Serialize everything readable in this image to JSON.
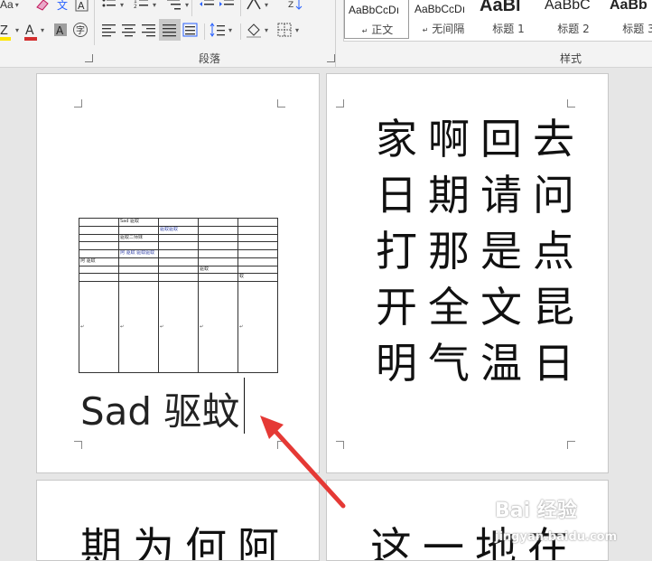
{
  "ribbon": {
    "paragraph_group_label": "段落",
    "styles_group_label": "样式",
    "font_cutoff_text": "Aa",
    "font_color": "#d32f2f",
    "highlight_color": "#ffe600",
    "styles": [
      {
        "sample": "AaBbCcDı",
        "name": "正文",
        "selected": true
      },
      {
        "sample": "AaBbCcDı",
        "name": "无间隔",
        "selected": false
      },
      {
        "sample": "AaBl",
        "name": "标题 1",
        "selected": false
      },
      {
        "sample": "AaBbC",
        "name": "标题 2",
        "selected": false
      },
      {
        "sample": "AaBb",
        "name": "标题 3",
        "selected": false
      }
    ]
  },
  "pages": {
    "page1": {
      "body_text": "Sad 驱蚊",
      "table": {
        "cells": [
          [
            "",
            "Sad 驱蚊",
            "",
            "",
            ""
          ],
          [
            "",
            "",
            "驱蚊驱蚊",
            "",
            ""
          ],
          [
            "",
            "驱蚊二师妹",
            "",
            "",
            ""
          ],
          [
            "",
            "",
            "",
            "",
            ""
          ],
          [
            "",
            "阿 驱蚊 驱蚊驱蚊 ",
            "",
            "",
            ""
          ],
          [
            "阿 驱蚊",
            "",
            "",
            "",
            ""
          ],
          [
            "",
            "",
            "",
            "驱蚊",
            ""
          ],
          [
            "",
            "",
            "",
            "",
            "蚊"
          ],
          [
            "↵",
            "↵",
            "↵",
            "↵",
            "↵"
          ]
        ]
      }
    },
    "page2": {
      "chars": [
        "家",
        "啊",
        "回",
        "去",
        "日",
        "期",
        "请",
        "问",
        "打",
        "那",
        "是",
        "点",
        "开",
        "全",
        "文",
        "昆",
        "明",
        "气",
        "温",
        "日"
      ]
    },
    "page3": {
      "chars": "期为何阿"
    },
    "page4": {
      "chars": "这一地在"
    }
  },
  "annotation": {
    "arrow_color": "#e53935"
  },
  "watermark": {
    "text": "Bai 经验",
    "sub": "jingyan.baidu.com"
  }
}
